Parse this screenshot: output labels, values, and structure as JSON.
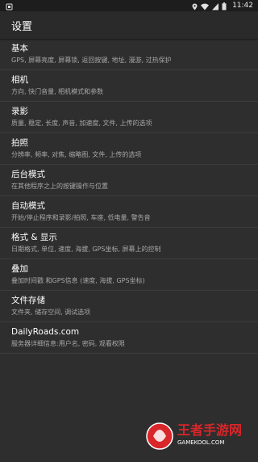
{
  "status_bar": {
    "time": "11:42"
  },
  "app_bar": {
    "title": "设置"
  },
  "settings": [
    {
      "title": "基本",
      "summary": "GPS, 屏幕亮度, 屏幕锁, 返回按键, 地址, 漫游, 过热保护"
    },
    {
      "title": "相机",
      "summary": "方向, 快门音量, 相机模式和参数"
    },
    {
      "title": "录影",
      "summary": "质量, 稳定, 长度, 声音, 加速度, 文件, 上传的选项"
    },
    {
      "title": "拍照",
      "summary": "分辨率, 频率, 对焦, 缩略图, 文件, 上传的选项"
    },
    {
      "title": "后台模式",
      "summary": "在其他程序之上的按键操作与位置"
    },
    {
      "title": "自动模式",
      "summary": "开始/停止程序和录影/拍照, 车座, 低电量, 警告音"
    },
    {
      "title": "格式 & 显示",
      "summary": "日期格式, 单位, 速度, 海拔, GPS坐标, 屏幕上的控制"
    },
    {
      "title": "叠加",
      "summary": "叠加时间戳 和GPS信息 (速度, 海拔, GPS坐标)"
    },
    {
      "title": "文件存储",
      "summary": "文件夹, 储存空间, 调试选项"
    },
    {
      "title": "DailyRoads.com",
      "summary": "服务器详细信息:用户名, 密码, 观看权限"
    }
  ],
  "watermark": {
    "main": "王者手游网",
    "sub": "GAMEKOOL.COM"
  }
}
